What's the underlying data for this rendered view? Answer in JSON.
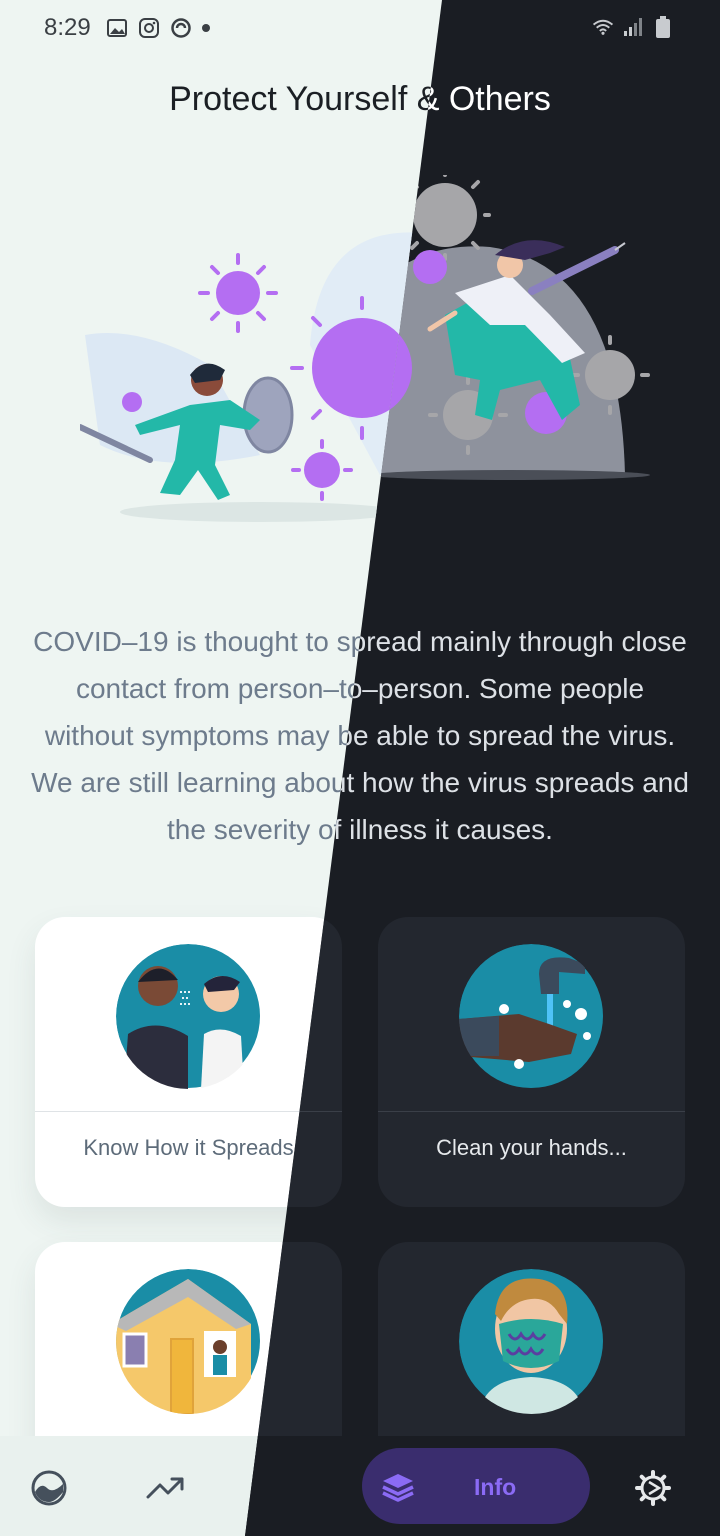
{
  "status_bar": {
    "time": "8:29"
  },
  "page": {
    "title": "Protect Yourself & Others",
    "description": "COVID–19 is thought to spread mainly through close contact from person–to–person. Some people without symptoms may be able to spread the virus. We are still learning about how the virus spreads and the severity of illness it causes."
  },
  "cards": [
    {
      "label": "Know How it Spreads",
      "icon": "people-sneezing-illustration"
    },
    {
      "label": "Clean your hands...",
      "icon": "handwashing-illustration"
    },
    {
      "label": "",
      "icon": "stay-home-illustration"
    },
    {
      "label": "",
      "icon": "face-mask-illustration"
    }
  ],
  "nav": {
    "items": [
      {
        "icon": "world-icon"
      },
      {
        "icon": "trending-icon"
      },
      {
        "icon": "location-pin-icon"
      },
      {
        "icon": "layers-icon",
        "label": "Info",
        "active": true
      },
      {
        "icon": "settings-icon"
      }
    ]
  },
  "colors": {
    "light_bg": "#eef5f2",
    "dark_bg": "#1a1d23",
    "accent": "#8b6bf5",
    "teal": "#1a8da6",
    "virus": "#b06ef0"
  }
}
